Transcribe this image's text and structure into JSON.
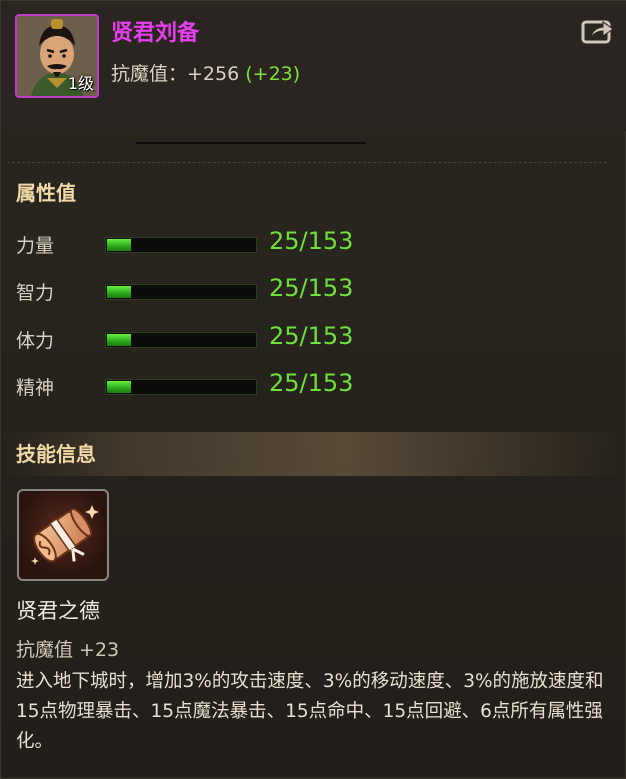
{
  "hero": {
    "name": "贤君刘备",
    "level_badge": "1级",
    "stat_label": "抗魔值：",
    "stat_value": "+256",
    "stat_bonus": "(+23)"
  },
  "sections": {
    "attributes_title": "属性值",
    "skills_title": "技能信息"
  },
  "attributes": [
    {
      "label": "力量",
      "value": "25/153",
      "fill": 0.16
    },
    {
      "label": "智力",
      "value": "25/153",
      "fill": 0.16
    },
    {
      "label": "体力",
      "value": "25/153",
      "fill": 0.16
    },
    {
      "label": "精神",
      "value": "25/153",
      "fill": 0.16
    }
  ],
  "skill": {
    "icon": "scroll-icon",
    "name": "贤君之德",
    "stat": "抗魔值 +23",
    "description": "进入地下城时，增加3%的攻击速度、3%的移动速度、3%的施放速度和15点物理暴击、15点魔法暴击、15点命中、15点回避、6点所有属性强化。"
  },
  "colors": {
    "hero_name": "#e73ef0",
    "bonus": "#7ee23a",
    "attr_value": "#6fe03a",
    "section_title": "#f0d9a6"
  }
}
